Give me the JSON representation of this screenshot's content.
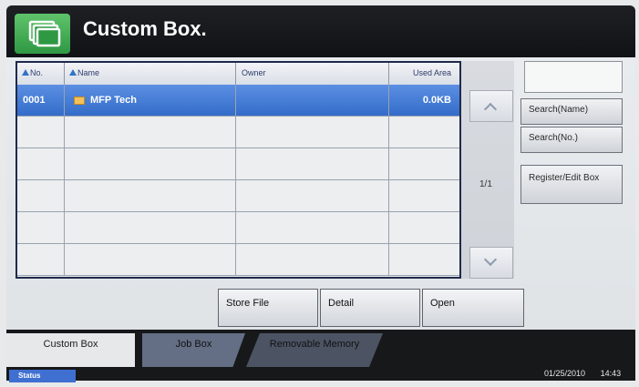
{
  "header": {
    "title": "Custom Box."
  },
  "table": {
    "columns": [
      "No.",
      "Name",
      "Owner",
      "Used Area"
    ],
    "rows": [
      {
        "no": "0001",
        "name": "MFP Tech",
        "owner": "",
        "used": "0.0KB",
        "selected": true
      },
      {
        "no": "",
        "name": "",
        "owner": "",
        "used": "",
        "selected": false
      },
      {
        "no": "",
        "name": "",
        "owner": "",
        "used": "",
        "selected": false
      },
      {
        "no": "",
        "name": "",
        "owner": "",
        "used": "",
        "selected": false
      },
      {
        "no": "",
        "name": "",
        "owner": "",
        "used": "",
        "selected": false
      },
      {
        "no": "",
        "name": "",
        "owner": "",
        "used": "",
        "selected": false
      }
    ],
    "page_indicator": "1/1"
  },
  "right_panel": {
    "search_value": "",
    "search_name_label": "Search(Name)",
    "search_no_label": "Search(No.)",
    "register_edit_label": "Register/Edit Box"
  },
  "actions": {
    "store_file": "Store File",
    "detail": "Detail",
    "open": "Open"
  },
  "tabs": [
    {
      "label": "Custom Box"
    },
    {
      "label": "Job Box"
    },
    {
      "label": "Removable Memory"
    }
  ],
  "status_bar": {
    "status_label": "Status",
    "date": "01/25/2010",
    "time": "14:43"
  },
  "colors": {
    "header_bg": "#111216",
    "accent_green": "#3aa84d",
    "selected_row": "#336cc9",
    "status_blue": "#3f6fd1"
  },
  "icons": {
    "header": "box-folders-icon",
    "row_folder": "folder-icon",
    "scroll_up": "chevron-up-icon",
    "scroll_down": "chevron-down-icon"
  }
}
